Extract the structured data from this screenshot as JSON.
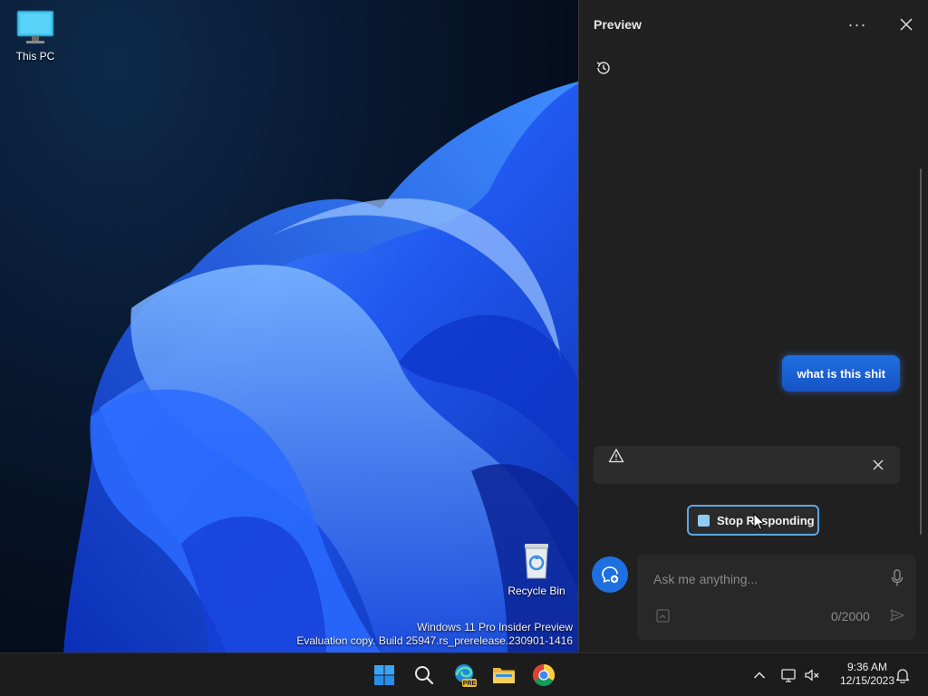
{
  "desktop": {
    "icons": [
      {
        "label": "This PC"
      },
      {
        "label": "Recycle Bin"
      }
    ],
    "watermark": {
      "line1": "Windows 11 Pro Insider Preview",
      "line2": "Evaluation copy. Build 25947.rs_prerelease.230901-1416"
    }
  },
  "panel": {
    "title": "Preview",
    "more_icon": "more-horizontal-icon",
    "close_icon": "close-icon",
    "history_icon": "history-icon",
    "user_message": "what is this shit",
    "alert": {
      "icon": "warning-icon",
      "close_icon": "close-icon"
    },
    "stop_button": {
      "label": "Stop Responding",
      "icon": "stop-square-icon"
    },
    "compose": {
      "placeholder": "Ask me anything...",
      "counter": "0/2000",
      "mic_icon": "microphone-icon",
      "image_icon": "add-image-icon",
      "send_icon": "send-icon"
    },
    "new_topic_icon": "new-topic-icon"
  },
  "taskbar": {
    "apps": [
      "start-icon",
      "search-icon",
      "edge-preview-icon",
      "file-explorer-icon",
      "chrome-icon"
    ],
    "tray": [
      "chevron-up-icon",
      "network-icon",
      "volume-muted-icon"
    ],
    "time": "9:36 AM",
    "date": "12/15/2023",
    "notification_icon": "bell-icon"
  },
  "colors": {
    "accent": "#1e6fe0",
    "panel_bg": "#202020",
    "taskbar_bg": "#1c1c1c",
    "stop_border": "#5aa7e6"
  }
}
